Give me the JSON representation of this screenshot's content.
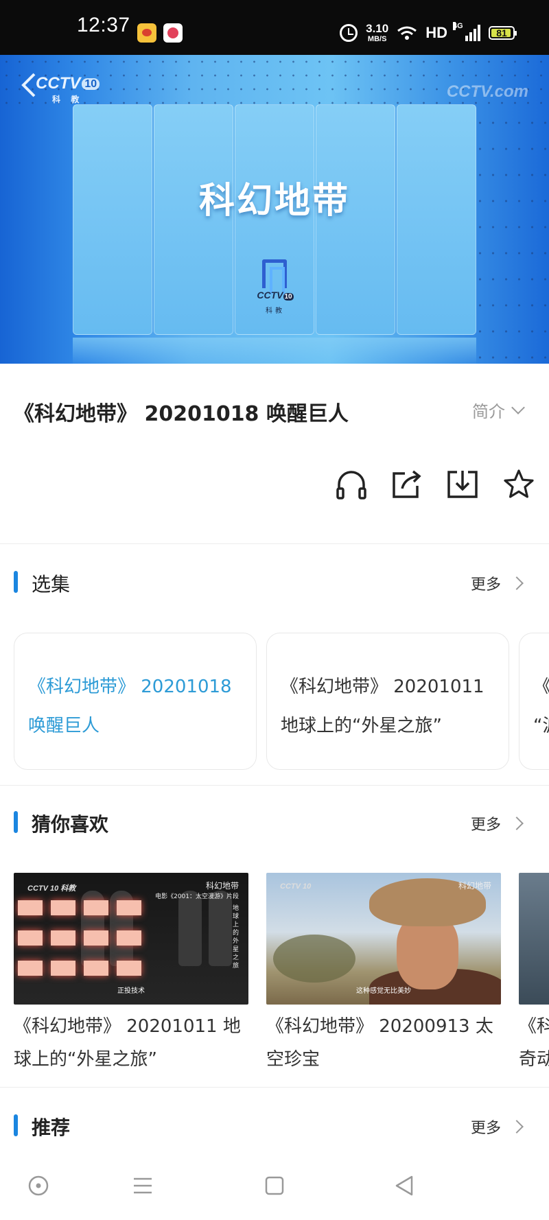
{
  "status_bar": {
    "time": "12:37",
    "net_speed": "3.10",
    "net_unit": "MB/S",
    "hd": "HD",
    "network": "4G",
    "battery": "81",
    "icons": [
      "weibo-icon",
      "app-icon",
      "alarm-icon",
      "wifi-icon",
      "signal-icon",
      "battery-icon"
    ]
  },
  "player": {
    "title": "科幻地带",
    "logo_top_left": "CCTV",
    "logo_top_left_channel": "10",
    "logo_top_left_sub": "科 教",
    "watermark": "CCTV.com",
    "center_logo": "CCTV",
    "center_logo_channel": "10",
    "center_logo_sub": "科教"
  },
  "program": {
    "title": "《科幻地带》 20201018 唤醒巨人",
    "intro_label": "简介"
  },
  "actions": [
    "headphones-icon",
    "share-icon",
    "download-icon",
    "star-icon"
  ],
  "sections": {
    "episodes": {
      "title": "选集",
      "more": "更多"
    },
    "guess": {
      "title": "猜你喜欢",
      "more": "更多"
    },
    "recommend": {
      "title": "推荐",
      "more": "更多"
    }
  },
  "episodes": [
    {
      "line1": "《科幻地带》 20201018",
      "line2": "唤醒巨人",
      "active": true
    },
    {
      "line1": "《科幻地带》 20201011",
      "line2": "地球上的“外星之旅”",
      "active": false
    },
    {
      "line1": "《",
      "line2": "“波",
      "active": false
    }
  ],
  "recommendations": [
    {
      "line1": "《科幻地带》 20201011 地",
      "line2": "球上的“外星之旅”",
      "thumb_logo": "CCTV 10 科教",
      "thumb_tag": "科幻地带",
      "thumb_sub": "电影《2001：太空漫游》片段",
      "thumb_side": "地球上的外星之旅",
      "thumb_caption": "正投技术"
    },
    {
      "line1": "《科幻地带》 20200913 太",
      "line2": "空珍宝",
      "thumb_logo": "CCTV 10",
      "thumb_tag": "科幻地带",
      "thumb_caption": "这种感觉无比美妙"
    },
    {
      "line1": "《科",
      "line2": "奇动"
    }
  ],
  "nav": [
    "home-circle-icon",
    "menu-icon",
    "square-icon",
    "back-triangle-icon"
  ]
}
